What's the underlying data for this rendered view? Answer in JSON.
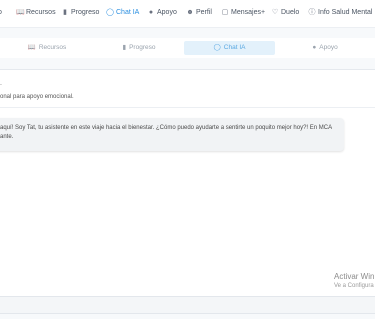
{
  "nav": {
    "items": [
      {
        "label": "o",
        "icon": "home-icon",
        "active": false
      },
      {
        "label": "Recursos",
        "icon": "book-icon",
        "active": false
      },
      {
        "label": "Progreso",
        "icon": "bar-chart-icon",
        "active": false
      },
      {
        "label": "Chat IA",
        "icon": "chat-bubble-icon",
        "active": true
      },
      {
        "label": "Apoyo",
        "icon": "map-pin-icon",
        "active": false
      },
      {
        "label": "Perfil",
        "icon": "user-icon",
        "active": false
      },
      {
        "label": "Mensajes+",
        "icon": "message-plus-icon",
        "active": false
      },
      {
        "label": "Duelo",
        "icon": "heart-icon",
        "active": false
      },
      {
        "label": "Info Salud Mental",
        "icon": "info-icon",
        "active": false
      }
    ]
  },
  "subtabs": {
    "items": [
      {
        "label": "Recursos",
        "icon": "book-icon",
        "active": false
      },
      {
        "label": "Progreso",
        "icon": "bar-chart-icon",
        "active": false
      },
      {
        "label": "Chat IA",
        "icon": "chat-bubble-icon",
        "active": true
      },
      {
        "label": "Apoyo",
        "icon": "map-pin-icon",
        "active": false
      }
    ]
  },
  "chat": {
    "header_fragment": ".",
    "subtitle": "onal para apoyo emocional.",
    "message": {
      "line1": "aquí! Soy Tat, tu asistente en este viaje hacia el bienestar. ¿Cómo puedo ayudarte a sentirte un poquito mejor hoy?! En MCA, cada",
      "line2": "ante."
    }
  },
  "watermark": {
    "title": "Activar Win",
    "subtitle": "Ve a Configura"
  },
  "colors": {
    "accent": "#2b8fe0",
    "active_tab_bg": "#e3f1fb",
    "bubble_bg": "#f1f3f5"
  }
}
